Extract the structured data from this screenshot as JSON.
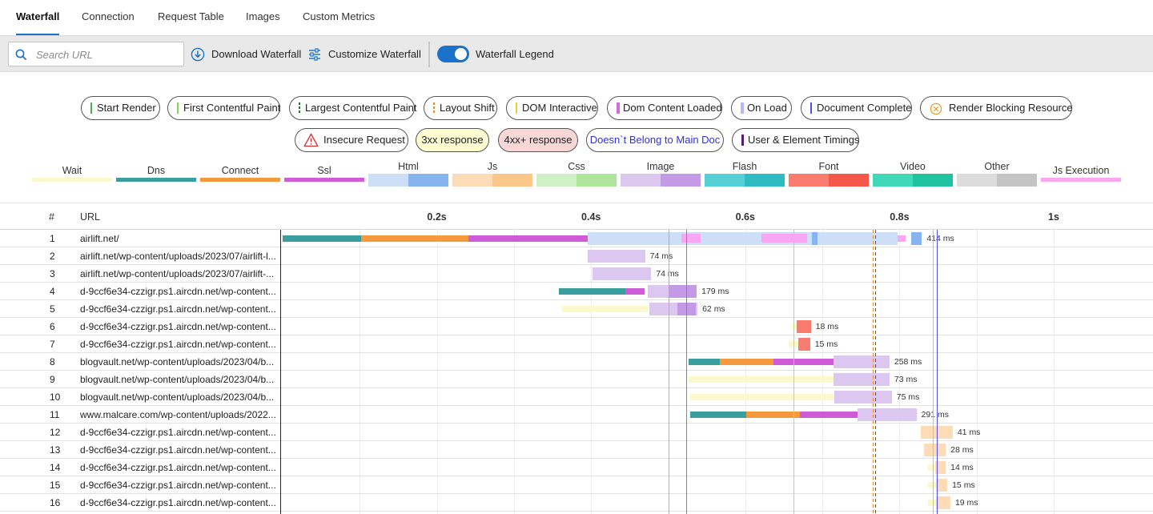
{
  "tabs": [
    {
      "label": "Waterfall",
      "active": true
    },
    {
      "label": "Connection"
    },
    {
      "label": "Request Table"
    },
    {
      "label": "Images"
    },
    {
      "label": "Custom Metrics"
    }
  ],
  "toolbar": {
    "search_placeholder": "Search URL",
    "download_label": "Download Waterfall",
    "customize_label": "Customize Waterfall",
    "legend_toggle_label": "Waterfall Legend",
    "legend_toggle_on": true
  },
  "legend": {
    "row1": [
      {
        "label": "Start Render",
        "marker": "#4caf50",
        "style": "solid"
      },
      {
        "label": "First Contentful Paint",
        "marker": "#7ed957",
        "style": "solid"
      },
      {
        "label": "Largest Contentful Paint",
        "marker": "#1e7a1e",
        "style": "dashed"
      },
      {
        "label": "Layout Shift",
        "marker": "#f08a24",
        "style": "dashed"
      },
      {
        "label": "DOM Interactive",
        "marker": "#f5c542",
        "style": "solid"
      },
      {
        "label": "Dom Content Loaded",
        "marker": "#d66ad6",
        "style": "solid"
      },
      {
        "label": "On Load",
        "marker": "#b8b8f5",
        "style": "solid"
      },
      {
        "label": "Document Complete",
        "marker": "#5050e0",
        "style": "solid"
      },
      {
        "label": "Render Blocking Resource",
        "marker": "render-blocking-icon",
        "style": "icon"
      }
    ],
    "row2": [
      {
        "label": "Insecure Request",
        "marker": "warning-triangle-icon"
      },
      {
        "label": "3xx response",
        "bg": "#fdfbd0"
      },
      {
        "label": "4xx+ response",
        "bg": "#f9d7d7"
      },
      {
        "label": "Doesn`t Belong to Main Doc",
        "color": "#3333cc"
      },
      {
        "label": "User & Element Timings",
        "marker": "#5a1a7a"
      }
    ],
    "categories": [
      {
        "label": "Wait",
        "colors": [
          "#fbf8cc"
        ]
      },
      {
        "label": "Dns",
        "colors": [
          "#3a9e9e"
        ]
      },
      {
        "label": "Connect",
        "colors": [
          "#f59a3c"
        ]
      },
      {
        "label": "Ssl",
        "colors": [
          "#cf5bd6"
        ]
      },
      {
        "label": "Html",
        "colors": [
          "#cddff7",
          "#86b4f0"
        ]
      },
      {
        "label": "Js",
        "colors": [
          "#fcdcb6",
          "#fbc68a"
        ]
      },
      {
        "label": "Css",
        "colors": [
          "#cff0c4",
          "#aee59a"
        ]
      },
      {
        "label": "Image",
        "colors": [
          "#dcc7f0",
          "#c49ae6"
        ]
      },
      {
        "label": "Flash",
        "colors": [
          "#56d0d6",
          "#2ebcc3"
        ]
      },
      {
        "label": "Font",
        "colors": [
          "#f97c6e",
          "#f5574a"
        ]
      },
      {
        "label": "Video",
        "colors": [
          "#3fd9b9",
          "#20c39f"
        ]
      },
      {
        "label": "Other",
        "colors": [
          "#dcdcdc",
          "#c4c4c4"
        ]
      },
      {
        "label": "Js Execution",
        "colors": [
          "#fba6f2"
        ]
      }
    ]
  },
  "waterfall": {
    "header": {
      "num": "#",
      "url": "URL"
    },
    "ticks": [
      {
        "label": "0.2s",
        "t": 0.2
      },
      {
        "label": "0.4s",
        "t": 0.4
      },
      {
        "label": "0.6s",
        "t": 0.6
      },
      {
        "label": "0.8s",
        "t": 0.8
      },
      {
        "label": "1s",
        "t": 1.0
      }
    ],
    "events": [
      {
        "name": "start-render",
        "t": 0.5,
        "color": "#7ed957",
        "style": "solid"
      },
      {
        "name": "first-contentful-paint",
        "t": 0.523,
        "color": "#4caf50",
        "style": "solid"
      },
      {
        "name": "dom-interactive",
        "t": 0.663,
        "color": "#f5c542",
        "style": "solid"
      },
      {
        "name": "layout-shift",
        "t": 0.765,
        "color": "#f08a24",
        "style": "dashed"
      },
      {
        "name": "largest-contentful-paint",
        "t": 0.768,
        "color": "#1e7a1e",
        "style": "dashed"
      },
      {
        "name": "dom-content-loaded",
        "t": 0.843,
        "color": "#d66ad6",
        "style": "solid"
      },
      {
        "name": "on-load",
        "t": 0.843,
        "color": "#b8b8f5",
        "style": "solid"
      },
      {
        "name": "document-complete",
        "t": 0.848,
        "color": "#5050e0",
        "style": "solid"
      }
    ],
    "rows": [
      {
        "num": "1",
        "url": "airlift.net/",
        "duration": "414 ms",
        "segments": [
          {
            "s": 0.0,
            "e": 0.102,
            "c": "#3a9e9e"
          },
          {
            "s": 0.102,
            "e": 0.241,
            "c": "#f59a3c"
          },
          {
            "s": 0.241,
            "e": 0.396,
            "c": "#cf5bd6"
          },
          {
            "s": 0.396,
            "e": 0.798,
            "c": "#cddff7"
          },
          {
            "s": 0.686,
            "e": 0.694,
            "c": "#86b4f0"
          },
          {
            "s": 0.798,
            "e": 0.808,
            "c": "#fba6f2"
          },
          {
            "s": 0.815,
            "e": 0.829,
            "c": "#86b4f0"
          }
        ],
        "extras": [
          {
            "s": 0.517,
            "e": 0.542,
            "c": "#fba6f2"
          },
          {
            "s": 0.621,
            "e": 0.68,
            "c": "#fba6f2"
          }
        ]
      },
      {
        "num": "2",
        "url": "airlift.net/wp-content/uploads/2023/07/airlift-l...",
        "duration": "74 ms",
        "segments": [
          {
            "s": 0.396,
            "e": 0.47,
            "c": "#dcc7f0"
          }
        ]
      },
      {
        "num": "3",
        "url": "airlift.net/wp-content/uploads/2023/07/airlift-...",
        "duration": "74 ms",
        "segments": [
          {
            "s": 0.402,
            "e": 0.478,
            "c": "#dcc7f0"
          }
        ]
      },
      {
        "num": "4",
        "url": "d-9ccf6e34-czzigr.ps1.aircdn.net/wp-content...",
        "duration": "179 ms",
        "segments": [
          {
            "s": 0.358,
            "e": 0.444,
            "c": "#3a9e9e"
          },
          {
            "s": 0.444,
            "e": 0.469,
            "c": "#cf5bd6"
          },
          {
            "s": 0.474,
            "e": 0.537,
            "c": "#dcc7f0"
          },
          {
            "s": 0.502,
            "e": 0.537,
            "c": "#c49ae6"
          }
        ]
      },
      {
        "num": "5",
        "url": "d-9ccf6e34-czzigr.ps1.aircdn.net/wp-content...",
        "duration": "62 ms",
        "segments": [
          {
            "s": 0.362,
            "e": 0.475,
            "c": "#fbf8cc"
          },
          {
            "s": 0.476,
            "e": 0.538,
            "c": "#dcc7f0"
          },
          {
            "s": 0.512,
            "e": 0.536,
            "c": "#c49ae6"
          }
        ]
      },
      {
        "num": "6",
        "url": "d-9ccf6e34-czzigr.ps1.aircdn.net/wp-content...",
        "duration": "18 ms",
        "segments": [
          {
            "s": 0.661,
            "e": 0.667,
            "c": "#fbf8cc"
          },
          {
            "s": 0.667,
            "e": 0.685,
            "c": "#f97c6e"
          }
        ]
      },
      {
        "num": "7",
        "url": "d-9ccf6e34-czzigr.ps1.aircdn.net/wp-content...",
        "duration": "15 ms",
        "segments": [
          {
            "s": 0.656,
            "e": 0.669,
            "c": "#fbf8cc"
          },
          {
            "s": 0.669,
            "e": 0.684,
            "c": "#f97c6e"
          }
        ]
      },
      {
        "num": "8",
        "url": "blogvault.net/wp-content/uploads/2023/04/b...",
        "duration": "258 ms",
        "segments": [
          {
            "s": 0.526,
            "e": 0.567,
            "c": "#3a9e9e"
          },
          {
            "s": 0.567,
            "e": 0.637,
            "c": "#f59a3c"
          },
          {
            "s": 0.637,
            "e": 0.714,
            "c": "#cf5bd6"
          },
          {
            "s": 0.714,
            "e": 0.787,
            "c": "#dcc7f0"
          }
        ]
      },
      {
        "num": "9",
        "url": "blogvault.net/wp-content/uploads/2023/04/b...",
        "duration": "73 ms",
        "segments": [
          {
            "s": 0.526,
            "e": 0.714,
            "c": "#fbf8cc"
          },
          {
            "s": 0.714,
            "e": 0.787,
            "c": "#dcc7f0"
          }
        ]
      },
      {
        "num": "10",
        "url": "blogvault.net/wp-content/uploads/2023/04/b...",
        "duration": "75 ms",
        "segments": [
          {
            "s": 0.529,
            "e": 0.715,
            "c": "#fbf8cc"
          },
          {
            "s": 0.715,
            "e": 0.79,
            "c": "#dcc7f0"
          }
        ]
      },
      {
        "num": "11",
        "url": "www.malcare.com/wp-content/uploads/2022...",
        "duration": "291 ms",
        "segments": [
          {
            "s": 0.529,
            "e": 0.601,
            "c": "#3a9e9e"
          },
          {
            "s": 0.601,
            "e": 0.671,
            "c": "#f59a3c"
          },
          {
            "s": 0.671,
            "e": 0.746,
            "c": "#cf5bd6"
          },
          {
            "s": 0.746,
            "e": 0.822,
            "c": "#dcc7f0"
          }
        ]
      },
      {
        "num": "12",
        "url": "d-9ccf6e34-czzigr.ps1.aircdn.net/wp-content...",
        "duration": "41 ms",
        "segments": [
          {
            "s": 0.828,
            "e": 0.869,
            "c": "#fcdcb6"
          }
        ]
      },
      {
        "num": "13",
        "url": "d-9ccf6e34-czzigr.ps1.aircdn.net/wp-content...",
        "duration": "28 ms",
        "segments": [
          {
            "s": 0.832,
            "e": 0.86,
            "c": "#fcdcb6"
          }
        ]
      },
      {
        "num": "14",
        "url": "d-9ccf6e34-czzigr.ps1.aircdn.net/wp-content...",
        "duration": "14 ms",
        "segments": [
          {
            "s": 0.837,
            "e": 0.846,
            "c": "#fbf8cc"
          },
          {
            "s": 0.846,
            "e": 0.86,
            "c": "#fcdcb6"
          }
        ]
      },
      {
        "num": "15",
        "url": "d-9ccf6e34-czzigr.ps1.aircdn.net/wp-content...",
        "duration": "15 ms",
        "segments": [
          {
            "s": 0.837,
            "e": 0.847,
            "c": "#fbf8cc"
          },
          {
            "s": 0.847,
            "e": 0.862,
            "c": "#fcdcb6"
          }
        ]
      },
      {
        "num": "16",
        "url": "d-9ccf6e34-czzigr.ps1.aircdn.net/wp-content...",
        "duration": "19 ms",
        "segments": [
          {
            "s": 0.837,
            "e": 0.847,
            "c": "#fbf8cc"
          },
          {
            "s": 0.847,
            "e": 0.866,
            "c": "#fcdcb6"
          }
        ]
      }
    ]
  }
}
